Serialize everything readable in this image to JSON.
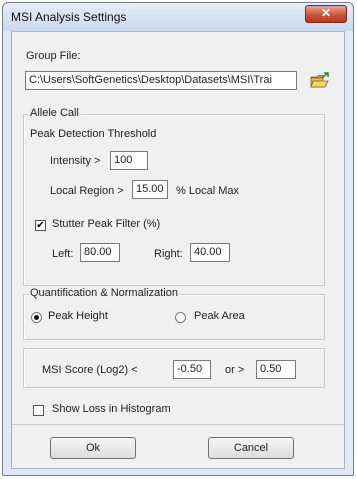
{
  "window": {
    "title": "MSI Analysis Settings",
    "close_glyph": "✕"
  },
  "group_file": {
    "label": "Group File:",
    "path": "C:\\Users\\SoftGenetics\\Desktop\\Datasets\\MSI\\Trai",
    "browse_icon": "folder-open-icon"
  },
  "allele_call": {
    "legend": "Allele Call",
    "peak_detection_label": "Peak Detection Threshold",
    "intensity_label": "Intensity >",
    "intensity_value": "100",
    "local_region_label": "Local Region >",
    "local_region_value": "15.00",
    "local_max_label": "% Local Max",
    "stutter_label": "Stutter Peak Filter (%)",
    "stutter_checked": true,
    "left_label": "Left:",
    "left_value": "80.00",
    "right_label": "Right:",
    "right_value": "40.00"
  },
  "quantification": {
    "legend": "Quantification & Normalization",
    "options": [
      {
        "label": "Peak Height",
        "selected": true
      },
      {
        "label": "Peak Area",
        "selected": false
      }
    ]
  },
  "msi_score": {
    "label": "MSI Score (Log2)  <",
    "low_value": "-0.50",
    "or_label": "or  >",
    "high_value": "0.50"
  },
  "show_loss": {
    "label": "Show Loss in Histogram",
    "checked": false
  },
  "buttons": {
    "ok": "Ok",
    "cancel": "Cancel"
  }
}
